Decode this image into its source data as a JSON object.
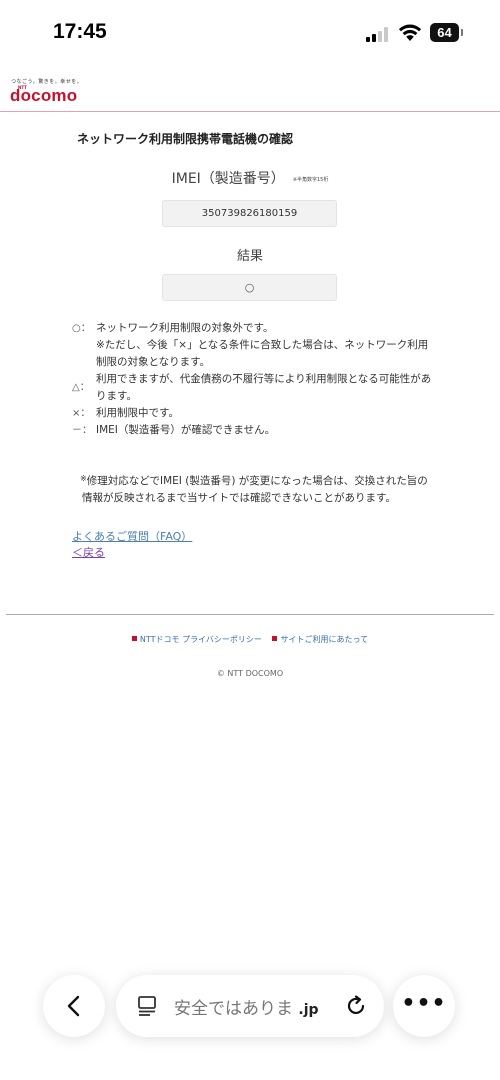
{
  "status_bar": {
    "time": "17:45",
    "battery": "64"
  },
  "header": {
    "tagline": "つなごう。驚きを。幸せを。",
    "logo_ntt": "NTT",
    "logo": "docomo",
    "brand_color": "#c8102e"
  },
  "main": {
    "title": "ネットワーク利用制限携帯電話機の確認",
    "imei_label": "IMEI（製造番号）",
    "imei_note": "※半角数字15桁",
    "imei_value": "350739826180159",
    "result_label": "結果",
    "result_value": "○",
    "legend": [
      {
        "symbol": "○：",
        "text": "ネットワーク利用制限の対象外です。",
        "sub": "※ただし、今後「×」となる条件に合致した場合は、ネットワーク利用制限の対象となります。"
      },
      {
        "symbol": "△：",
        "text": "利用できますが、代金債務の不履行等により利用制限となる可能性があります。"
      },
      {
        "symbol": "×：",
        "text": "利用制限中です。"
      },
      {
        "symbol": "－：",
        "text": "IMEI（製造番号）が確認できません。"
      }
    ],
    "note_mark": "※",
    "note": "修理対応などでIMEI (製造番号) が変更になった場合は、交換された旨の情報が反映されるまで当サイトでは確認できないことがあります。",
    "faq_link": "よくあるご質問（FAQ）",
    "back_link": "＜戻る"
  },
  "footer": {
    "links": [
      "NTTドコモ プライバシーポリシー",
      "サイトご利用にあたって"
    ],
    "copyright": "© NTT DOCOMO"
  },
  "browser": {
    "address": "安全ではありま",
    "address_suffix": ".jp",
    "back_icon": "chevron-left-icon",
    "reload_icon": "reload-icon",
    "more_icon": "more-icon"
  }
}
